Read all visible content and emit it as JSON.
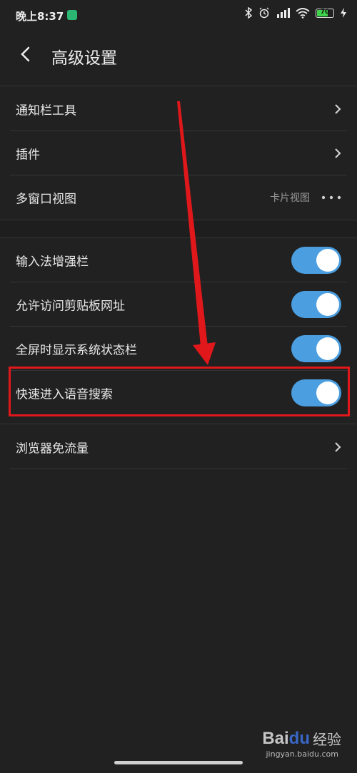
{
  "status_bar": {
    "time": "晚上8:37",
    "battery_level": "70",
    "battery_fraction": 0.7,
    "icons": [
      "bluetooth-icon",
      "alarm-icon",
      "hd-signal-icon",
      "wifi-icon",
      "battery-icon",
      "charging-icon"
    ]
  },
  "header": {
    "title": "高级设置",
    "back_icon": "chevron-left-icon"
  },
  "groups": [
    {
      "items": [
        {
          "label": "通知栏工具",
          "type": "link"
        },
        {
          "label": "插件",
          "type": "link"
        },
        {
          "label": "多窗口视图",
          "type": "value",
          "value": "卡片视图"
        }
      ]
    },
    {
      "items": [
        {
          "label": "输入法增强栏",
          "type": "toggle",
          "on": true
        },
        {
          "label": "允许访问剪贴板网址",
          "type": "toggle",
          "on": true
        },
        {
          "label": "全屏时显示系统状态栏",
          "type": "toggle",
          "on": true
        },
        {
          "label": "快速进入语音搜索",
          "type": "toggle",
          "on": true
        }
      ]
    },
    {
      "items": [
        {
          "label": "浏览器免流量",
          "type": "link"
        }
      ]
    }
  ],
  "colors": {
    "background": "#212121",
    "toggle_on": "#4b9ee0",
    "annotation": "#e0171b"
  },
  "watermark": {
    "logo_a": "Bai",
    "logo_b": "du",
    "text": "经验",
    "url": "jingyan.baidu.com"
  }
}
